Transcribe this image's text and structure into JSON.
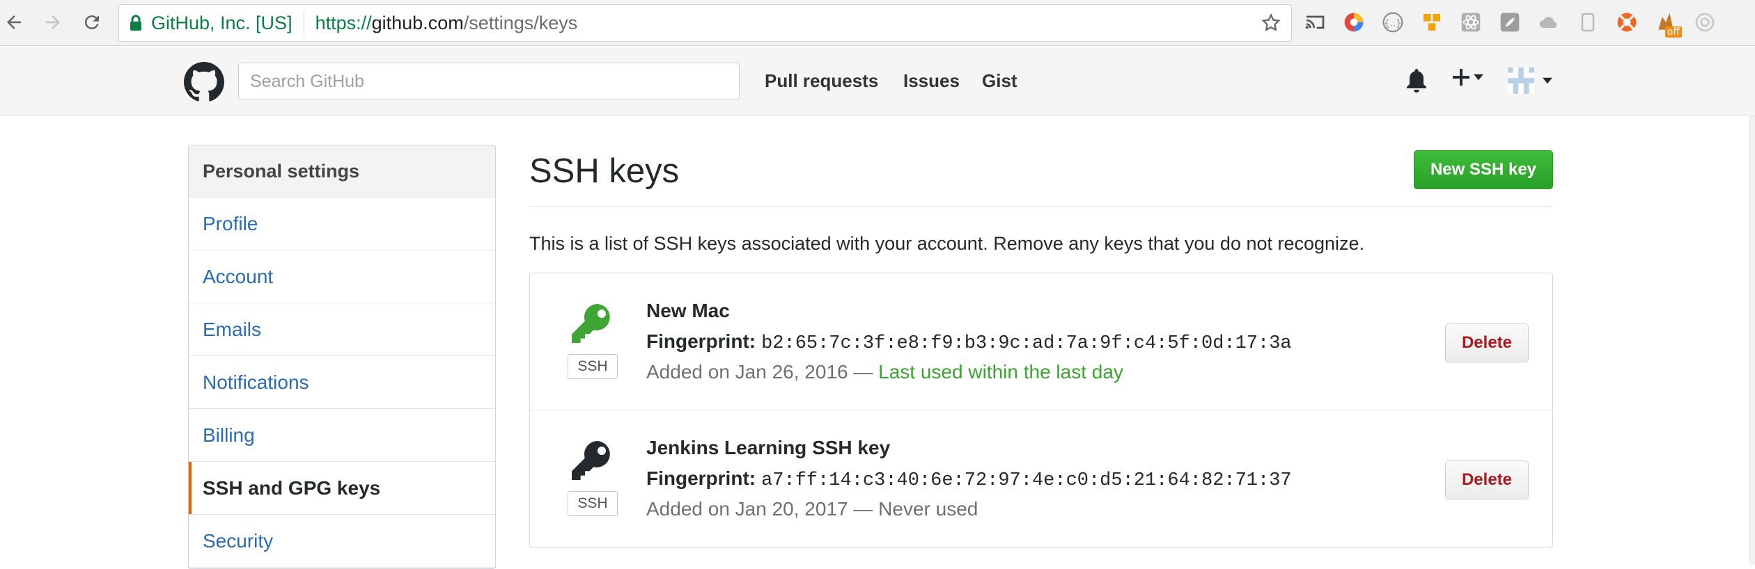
{
  "browser": {
    "org_label": "GitHub, Inc. [US]",
    "url_scheme": "https://",
    "url_host": "github.com",
    "url_path": "/settings/keys",
    "extensions": [
      {
        "name": "cast-icon",
        "color": "#555555"
      },
      {
        "name": "colorful-extension-icon",
        "color": "#e8453c"
      },
      {
        "name": "json-extension-icon",
        "color": "#8a8a8a"
      },
      {
        "name": "orange-blocks-extension-icon",
        "color": "#f0a30a"
      },
      {
        "name": "react-devtools-icon",
        "color": "#b0b0b0"
      },
      {
        "name": "gray-square-extension-icon",
        "color": "#9e9e9e"
      },
      {
        "name": "cloud-extension-icon",
        "color": "#b8b8b8"
      },
      {
        "name": "tablet-extension-icon",
        "color": "#b8b8b8"
      },
      {
        "name": "lifebuoy-extension-icon",
        "color": "#f26522"
      },
      {
        "name": "paused-extension-icon",
        "color": "#c07a2a",
        "badge": "off"
      },
      {
        "name": "target-extension-icon",
        "color": "#c8c8c8"
      }
    ]
  },
  "header": {
    "search_placeholder": "Search GitHub",
    "nav": [
      "Pull requests",
      "Issues",
      "Gist"
    ]
  },
  "sidebar": {
    "heading": "Personal settings",
    "items": [
      {
        "label": "Profile"
      },
      {
        "label": "Account"
      },
      {
        "label": "Emails"
      },
      {
        "label": "Notifications"
      },
      {
        "label": "Billing"
      },
      {
        "label": "SSH and GPG keys",
        "selected": true
      },
      {
        "label": "Security"
      }
    ]
  },
  "main": {
    "title": "SSH keys",
    "new_button": "New SSH key",
    "intro": "This is a list of SSH keys associated with your account. Remove any keys that you do not recognize.",
    "fingerprint_label": "Fingerprint:",
    "keys": [
      {
        "title": "New Mac",
        "fingerprint": "b2:65:7c:3f:e8:f9:b3:9c:ad:7a:9f:c4:5f:0d:17:3a",
        "added": "Added on Jan 26, 2016 — ",
        "last_used": "Last used within the last day",
        "badge": "SSH",
        "icon_color": "#3fa535",
        "delete": "Delete"
      },
      {
        "title": "Jenkins Learning SSH key",
        "fingerprint": "a7:ff:14:c3:40:6e:72:97:4e:c0:d5:21:64:82:71:37",
        "added": "Added on Jan 20, 2017 — ",
        "last_used": "Never used",
        "badge": "SSH",
        "icon_color": "#24292e",
        "delete": "Delete"
      }
    ]
  }
}
